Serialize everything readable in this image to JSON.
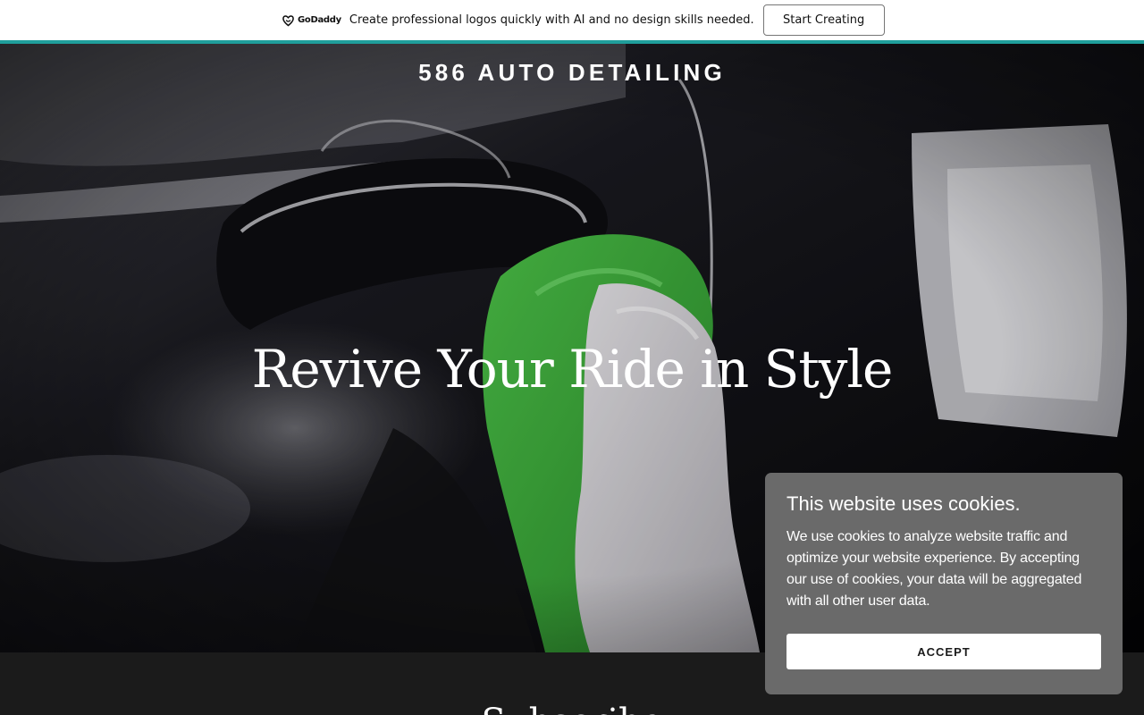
{
  "promo": {
    "logo_text": "GoDaddy",
    "message": "Create professional logos quickly with AI and no design skills needed.",
    "cta_label": "Start Creating",
    "accent_color": "#1f9e9b"
  },
  "hero": {
    "brand": "586 AUTO DETAILING",
    "title": "Revive Your Ride in Style",
    "image_description_icon": "car-detailing-photo"
  },
  "next_section": {
    "heading": "Subscribe"
  },
  "cookie_banner": {
    "title": "This website uses cookies.",
    "body": "We use cookies to analyze website traffic and optimize your website experience. By accepting our use of cookies, your data will be aggregated with all other user data.",
    "accept_label": "ACCEPT",
    "background_color": "#6a6a6a"
  }
}
